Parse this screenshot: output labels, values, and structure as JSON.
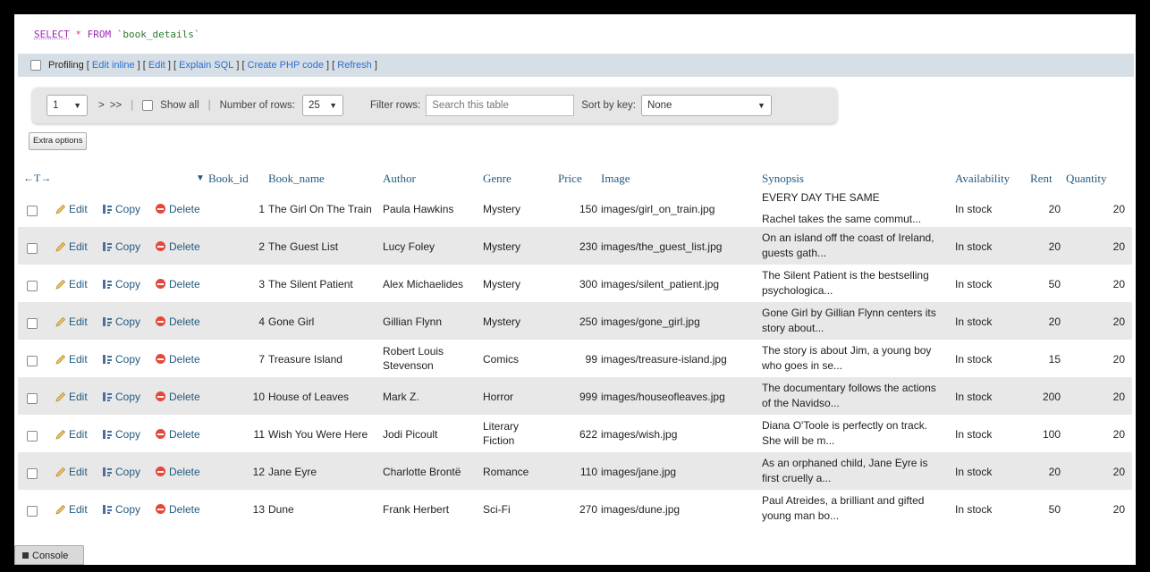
{
  "sql": {
    "select": "SELECT",
    "star": "*",
    "from": "FROM",
    "table": "`book_details`"
  },
  "profiling": {
    "label": "Profiling",
    "links": [
      "Edit inline",
      "Edit",
      "Explain SQL",
      "Create PHP code",
      "Refresh"
    ]
  },
  "nav": {
    "page": "1",
    "next": ">",
    "last": ">>",
    "show_all": "Show all",
    "rows_label": "Number of rows:",
    "rows_value": "25",
    "filter_label": "Filter rows:",
    "filter_placeholder": "Search this table",
    "sort_label": "Sort by key:",
    "sort_value": "None"
  },
  "extra_options": "Extra options",
  "columns": {
    "arrows": "←T→",
    "book_id": "Book_id",
    "book_name": "Book_name",
    "author": "Author",
    "genre": "Genre",
    "price": "Price",
    "image": "Image",
    "synopsis": "Synopsis",
    "availability": "Availability",
    "rent": "Rent",
    "quantity": "Quantity"
  },
  "actions": {
    "edit": "Edit",
    "copy": "Copy",
    "delete": "Delete"
  },
  "rows": [
    {
      "id": "1",
      "name": "The Girl On The Train",
      "author": "Paula Hawkins",
      "genre": "Mystery",
      "price": "150",
      "image": "images/girl_on_train.jpg",
      "syn1": "EVERY DAY THE SAME",
      "syn2": "Rachel takes the same commut...",
      "avail": "In stock",
      "rent": "20",
      "qty": "20"
    },
    {
      "id": "2",
      "name": "The Guest List",
      "author": "Lucy Foley",
      "genre": "Mystery",
      "price": "230",
      "image": "images/the_guest_list.jpg",
      "syn1": "On an island off the coast of Ireland,",
      "syn2": "guests gath...",
      "avail": "In stock",
      "rent": "20",
      "qty": "20"
    },
    {
      "id": "3",
      "name": "The Silent Patient",
      "author": "Alex Michaelides",
      "genre": "Mystery",
      "price": "300",
      "image": "images/silent_patient.jpg",
      "syn1": "The Silent Patient is the bestselling",
      "syn2": "psychologica...",
      "avail": "In stock",
      "rent": "50",
      "qty": "20"
    },
    {
      "id": "4",
      "name": "Gone Girl",
      "author": "Gillian Flynn",
      "genre": "Mystery",
      "price": "250",
      "image": "images/gone_girl.jpg",
      "syn1": "Gone Girl by Gillian Flynn centers its",
      "syn2": "story about...",
      "avail": "In stock",
      "rent": "20",
      "qty": "20"
    },
    {
      "id": "7",
      "name": "Treasure Island",
      "author": "Robert Louis",
      "author2": "Stevenson",
      "genre": "Comics",
      "price": "99",
      "image": "images/treasure-island.jpg",
      "syn1": "The story is about Jim, a young boy",
      "syn2": "who goes in se...",
      "avail": "In stock",
      "rent": "15",
      "qty": "20"
    },
    {
      "id": "10",
      "name": "House of Leaves",
      "author": "Mark Z.",
      "genre": "Horror",
      "price": "999",
      "image": "images/houseofleaves.jpg",
      "syn1": "The documentary follows the actions",
      "syn2": "of the Navidso...",
      "avail": "In stock",
      "rent": "200",
      "qty": "20"
    },
    {
      "id": "11",
      "name": "Wish You Were Here",
      "author": "Jodi Picoult",
      "genre": "Literary",
      "genre2": "Fiction",
      "price": "622",
      "image": "images/wish.jpg",
      "syn1": "Diana O'Toole is perfectly on track.",
      "syn2": "She will be m...",
      "avail": "In stock",
      "rent": "100",
      "qty": "20"
    },
    {
      "id": "12",
      "name": "Jane Eyre",
      "author": "Charlotte Brontë",
      "genre": "Romance",
      "price": "110",
      "image": "images/jane.jpg",
      "syn1": "As an orphaned child, Jane Eyre is",
      "syn2": "first cruelly a...",
      "avail": "In stock",
      "rent": "20",
      "qty": "20"
    },
    {
      "id": "13",
      "name": "Dune",
      "author": "Frank Herbert",
      "genre": "Sci-Fi",
      "price": "270",
      "image": "images/dune.jpg",
      "syn1": "Paul Atreides, a brilliant and gifted",
      "syn2": "young man bo...",
      "avail": "In stock",
      "rent": "50",
      "qty": "20"
    }
  ],
  "console": "Console"
}
